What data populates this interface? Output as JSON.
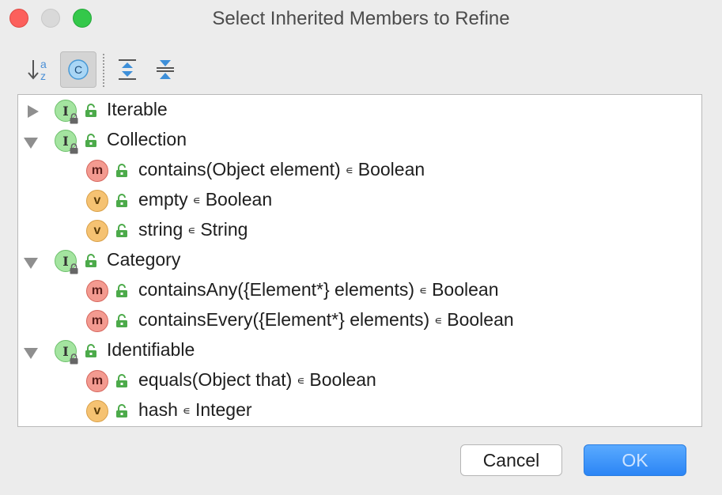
{
  "window": {
    "title": "Select Inherited Members to Refine"
  },
  "toolbar": {
    "items": [
      {
        "name": "sort-alphabetically-icon"
      },
      {
        "name": "show-classes-icon",
        "active": true
      },
      {
        "name": "expand-all-icon"
      },
      {
        "name": "collapse-all-icon"
      }
    ]
  },
  "tree": [
    {
      "kind": "I",
      "expanded": false,
      "name": "Iterable",
      "type": "",
      "children": []
    },
    {
      "kind": "I",
      "expanded": true,
      "name": "Collection",
      "type": "",
      "children": [
        {
          "kind": "m",
          "name": "contains(Object element)",
          "type": "Boolean"
        },
        {
          "kind": "v",
          "name": "empty",
          "type": "Boolean"
        },
        {
          "kind": "v",
          "name": "string",
          "type": "String"
        }
      ]
    },
    {
      "kind": "I",
      "expanded": true,
      "name": "Category",
      "type": "",
      "children": [
        {
          "kind": "m",
          "name": "containsAny({Element*} elements)",
          "type": "Boolean"
        },
        {
          "kind": "m",
          "name": "containsEvery({Element*} elements)",
          "type": "Boolean"
        }
      ]
    },
    {
      "kind": "I",
      "expanded": true,
      "name": "Identifiable",
      "type": "",
      "children": [
        {
          "kind": "m",
          "name": "equals(Object that)",
          "type": "Boolean"
        },
        {
          "kind": "v",
          "name": "hash",
          "type": "Integer"
        }
      ]
    }
  ],
  "type_separator": "∊",
  "badge_letters": {
    "I": "I",
    "m": "m",
    "v": "v"
  },
  "buttons": {
    "cancel": "Cancel",
    "ok": "OK"
  },
  "colors": {
    "interface_badge": "#a4e4a0",
    "method_badge": "#f39a90",
    "value_badge": "#f5c272",
    "lock_green": "#4caa4a",
    "ok_button": "#2b85f5"
  }
}
